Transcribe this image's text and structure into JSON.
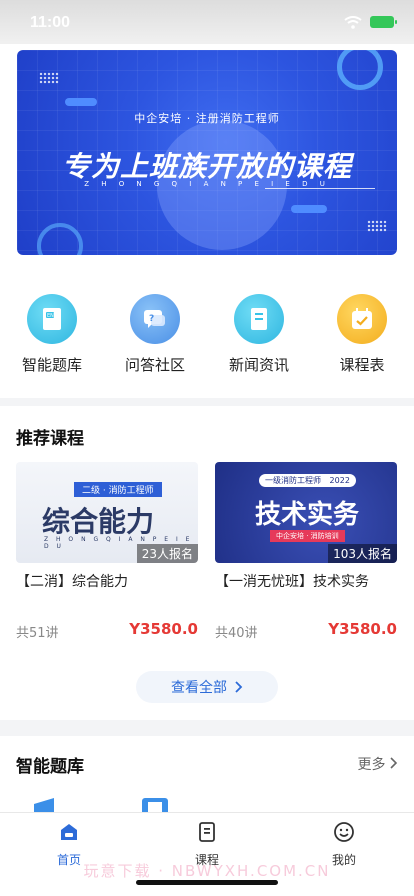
{
  "status": {
    "time": "11:00"
  },
  "banner": {
    "subtitle": "中企安培 · 注册消防工程师",
    "title": "专为上班族开放的课程",
    "pinyin": "Z H O N G Q I A N P E I E D U"
  },
  "quick_links": [
    {
      "label": "智能题库",
      "icon": "book-icon",
      "color": "#37c3e8"
    },
    {
      "label": "问答社区",
      "icon": "chat-question-icon",
      "color": "#4c9be8"
    },
    {
      "label": "新闻资讯",
      "icon": "news-icon",
      "color": "#37c3e8"
    },
    {
      "label": "课程表",
      "icon": "calendar-icon",
      "color": "#f5b72c"
    }
  ],
  "recommended": {
    "title": "推荐课程",
    "view_all": "查看全部",
    "courses": [
      {
        "cover_tag": "二级 · 消防工程师",
        "cover_title": "综合能力",
        "cover_pinyin": "Z H O N G Q I A N P E I E D U",
        "enrolled": "23人报名",
        "title": "【二消】综合能力",
        "lessons": "共51讲",
        "price": "Y3580.0"
      },
      {
        "cover_tag": "一级消防工程师",
        "cover_year": "2022",
        "cover_title": "技术实务",
        "cover_sub": "中企安培 · 消防培训",
        "enrolled": "103人报名",
        "title": "【一消无忧班】技术实务",
        "lessons": "共40讲",
        "price": "Y3580.0"
      }
    ]
  },
  "question_bank": {
    "title": "智能题库",
    "more": "更多"
  },
  "tabbar": {
    "items": [
      {
        "label": "首页",
        "icon": "home-icon",
        "active": true
      },
      {
        "label": "课程",
        "icon": "course-icon",
        "active": false
      },
      {
        "label": "我的",
        "icon": "profile-icon",
        "active": false
      }
    ]
  },
  "watermark": "玩意下载 · NBWYXH.COM.CN",
  "colors": {
    "accent": "#2c6bd8",
    "price": "#e53935"
  }
}
